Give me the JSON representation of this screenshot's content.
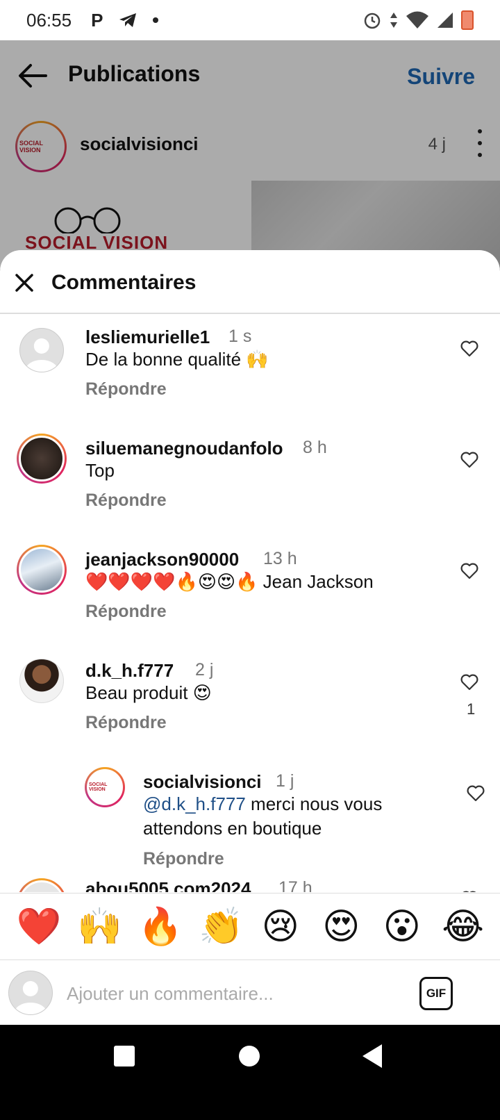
{
  "status_bar": {
    "time": "06:55",
    "left_icons": [
      "P",
      "telegram-icon",
      "dot"
    ],
    "right_icons": [
      "alarm-icon",
      "data-arrows-icon",
      "wifi-icon",
      "signal-icon",
      "battery-icon"
    ]
  },
  "publications": {
    "title": "Publications",
    "follow_label": "Suivre",
    "post": {
      "username": "socialvisionci",
      "time": "4 j",
      "logo_text": "SOCIAL VISION"
    }
  },
  "sheet": {
    "title": "Commentaires"
  },
  "comments": [
    {
      "username": "lesliemurielle1",
      "time": "1 s",
      "text": "De la bonne qualité 🙌",
      "reply": "Répondre",
      "avatar": "default-avatar"
    },
    {
      "username": "siluemanegnoudanfolo",
      "time": "8 h",
      "text": "Top",
      "reply": "Répondre",
      "avatar": "story-ring-avatar"
    },
    {
      "username": "jeanjackson90000",
      "time": "13 h",
      "text": "❤️❤️❤️❤️🔥😍😍🔥 Jean Jackson",
      "reply": "Répondre",
      "avatar": "story-ring-avatar"
    },
    {
      "username": "d.k_h.f777",
      "time": "2 j",
      "text": "Beau produit 😍",
      "reply": "Répondre",
      "likes": "1",
      "avatar": "photo-avatar"
    },
    {
      "username": "socialvisionci",
      "time": "1 j",
      "mention": "@d.k_h.f777",
      "text": " merci nous vous attendons en boutique",
      "reply": "Répondre",
      "avatar": "story-ring-avatar",
      "is_reply": true
    },
    {
      "username": "abou5005.com2024",
      "time": "17 h",
      "avatar": "story-ring-avatar"
    }
  ],
  "emoji_bar": [
    "❤️",
    "🙌",
    "🔥",
    "👏",
    "😢",
    "😍",
    "😮",
    "😂"
  ],
  "input": {
    "placeholder": "Ajouter un commentaire...",
    "gif_label": "GIF"
  },
  "colors": {
    "accent_blue": "#1f68b3",
    "mention_blue": "#1f4f87",
    "brand_red": "#b81c2b"
  }
}
